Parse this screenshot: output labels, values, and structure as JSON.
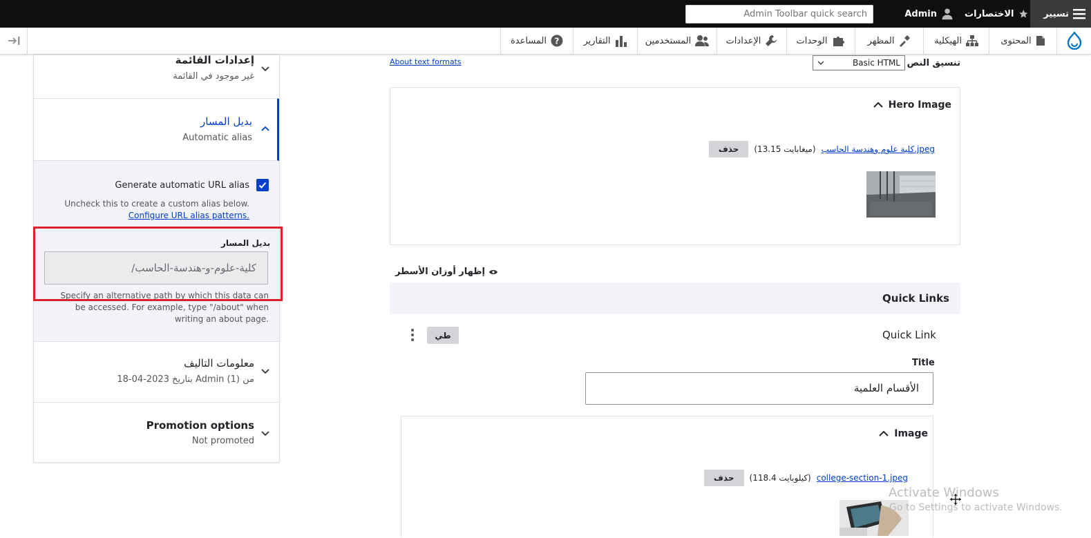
{
  "toolbar": {
    "manage": "تسيير",
    "shortcuts": "الاختصارات",
    "user": "Admin",
    "search_placeholder": "Admin Toolbar quick search"
  },
  "menu": {
    "content": "المحتوى",
    "structure": "الهيكلية",
    "appearance": "المظهر",
    "extend": "الوحدات",
    "config": "الإعدادات",
    "people": "المستخدمين",
    "reports": "التقارير",
    "help": "المساعدة"
  },
  "sidebar": {
    "menu_settings": {
      "title": "إعدادات القائمة",
      "summary": "غير موجود في القائمة"
    },
    "path_alias": {
      "title": "بديل المسار",
      "summary": "Automatic alias"
    },
    "generate_label": "Generate automatic URL alias",
    "generate_desc": "Uncheck this to create a custom alias below.",
    "configure_link": "Configure URL alias patterns.",
    "alias_field_label": "بديل المسار",
    "alias_value": "/كلية-علوم-و-هندسة-الحاسب",
    "alias_desc": "Specify an alternative path by which this data can be accessed. For example, type \"/about\" when writing an about page.",
    "authoring": {
      "title": "معلومات التاليف",
      "summary": "من (1) Admin بتاريخ  2023-04-18"
    },
    "promotion": {
      "title": "Promotion options",
      "summary": "Not promoted"
    }
  },
  "main": {
    "about_formats": "About text formats",
    "format_label": "تنسيق النص",
    "format_value": "Basic HTML",
    "hero": {
      "title": "Hero Image",
      "file_name": "كلية علوم وهندسة الحاسب.jpeg",
      "file_size": "(13.15 ميغابايت)",
      "delete": "حذف"
    },
    "show_weights": "إظهار أوزان الأسطر",
    "quick_links": {
      "title": "Quick Links",
      "item_label": "Quick Link",
      "collapse": "طي",
      "title_label": "Title",
      "title_value": "الأقسام العلمية"
    },
    "image": {
      "title": "Image",
      "file_name": "college-section-1.jpeg",
      "file_size": "(118.4 كيلوبايت)",
      "delete": "حذف"
    }
  },
  "watermark": {
    "line1": "Activate Windows",
    "line2": "Go to Settings to activate Windows."
  },
  "colors": {
    "accent": "#003ecc",
    "highlight": "#e0212b",
    "toolbar_bg": "#0f0f0f"
  }
}
